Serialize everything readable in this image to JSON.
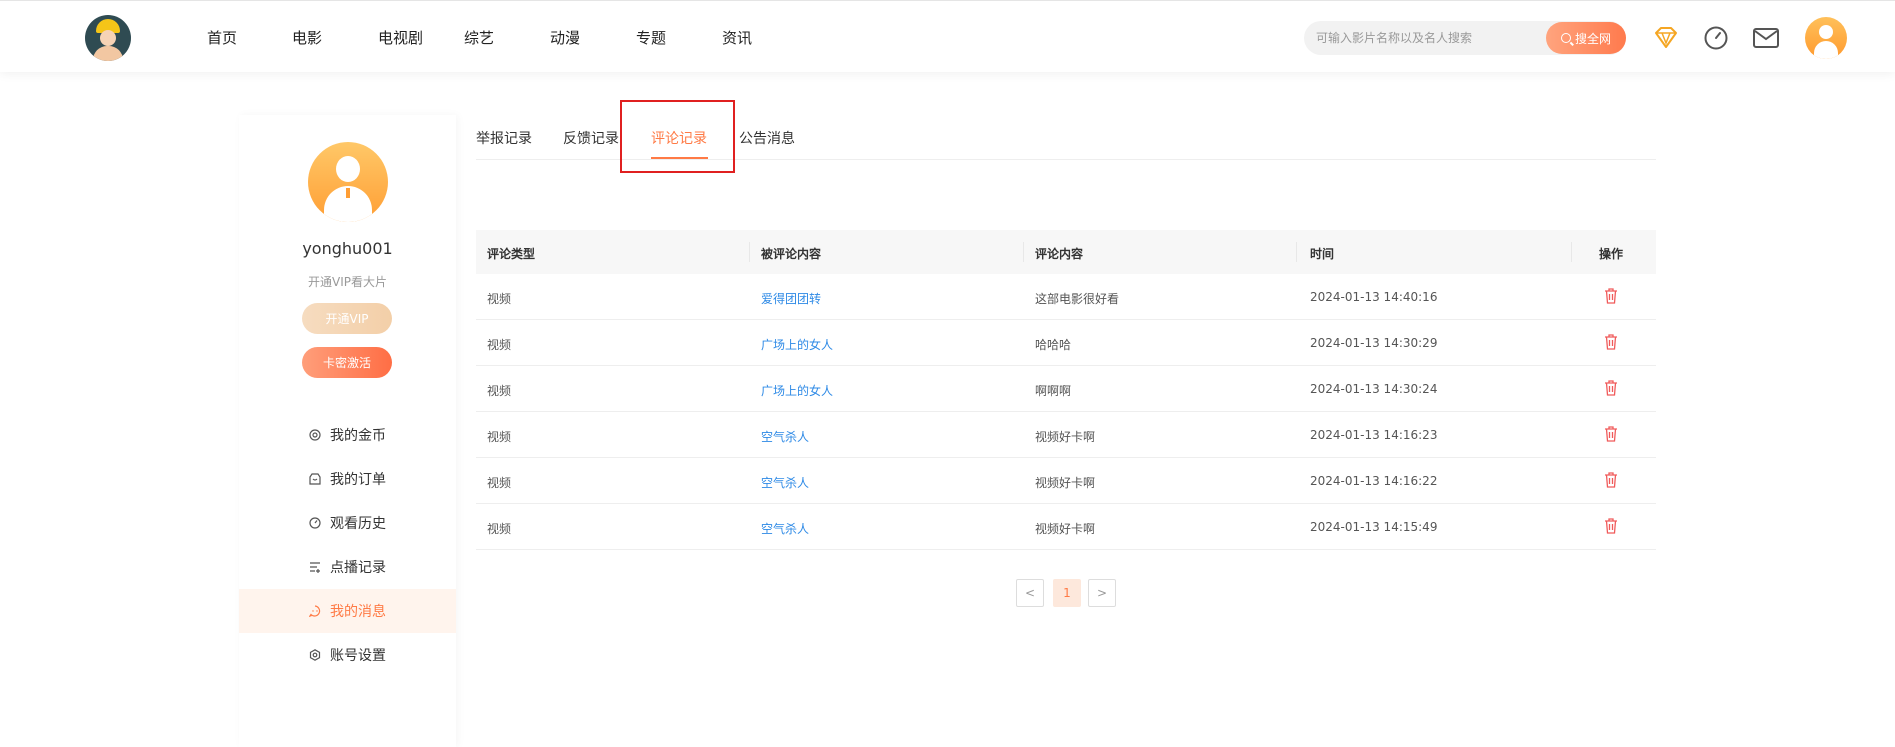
{
  "nav": {
    "items": [
      "首页",
      "电影",
      "电视剧",
      "综艺",
      "动漫",
      "专题",
      "资讯"
    ]
  },
  "search": {
    "placeholder": "可输入影片名称以及名人搜索",
    "button_label": "搜全网"
  },
  "header_icons": [
    "diamond-icon",
    "clock-icon",
    "mail-icon",
    "avatar"
  ],
  "sidebar": {
    "username": "yonghu001",
    "vip_tip": "开通VIP看大片",
    "vip_button": "开通VIP",
    "card_button": "卡密激活",
    "menu": [
      {
        "label": "我的金币",
        "icon": "coin-icon"
      },
      {
        "label": "我的订单",
        "icon": "order-icon"
      },
      {
        "label": "观看历史",
        "icon": "history-icon"
      },
      {
        "label": "点播记录",
        "icon": "playlist-icon"
      },
      {
        "label": "我的消息",
        "icon": "message-icon",
        "active": true
      },
      {
        "label": "账号设置",
        "icon": "settings-icon"
      }
    ]
  },
  "tabs": [
    "举报记录",
    "反馈记录",
    "评论记录",
    "公告消息"
  ],
  "active_tab": "评论记录",
  "table": {
    "headers": [
      "评论类型",
      "被评论内容",
      "评论内容",
      "时间",
      "操作"
    ],
    "rows": [
      {
        "type": "视频",
        "target": "爱得团团转",
        "content": "这部电影很好看",
        "time": "2024-01-13 14:40:16"
      },
      {
        "type": "视频",
        "target": "广场上的女人",
        "content": "哈哈哈",
        "time": "2024-01-13 14:30:29"
      },
      {
        "type": "视频",
        "target": "广场上的女人",
        "content": "啊啊啊",
        "time": "2024-01-13 14:30:24"
      },
      {
        "type": "视频",
        "target": "空气杀人",
        "content": "视频好卡啊",
        "time": "2024-01-13 14:16:23"
      },
      {
        "type": "视频",
        "target": "空气杀人",
        "content": "视频好卡啊",
        "time": "2024-01-13 14:16:22"
      },
      {
        "type": "视频",
        "target": "空气杀人",
        "content": "视频好卡啊",
        "time": "2024-01-13 14:15:49"
      }
    ]
  },
  "pagination": {
    "prev": "<",
    "current": "1",
    "next": ">"
  },
  "colors": {
    "accent": "#ff7a45",
    "link": "#2e8ae6",
    "delete": "#f05a5a"
  }
}
